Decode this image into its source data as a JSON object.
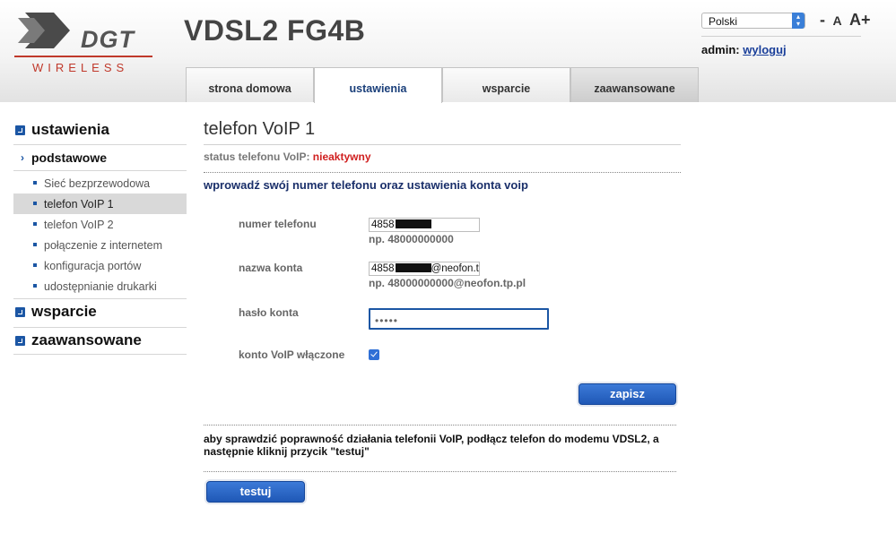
{
  "brand": {
    "logo_text": "DGT",
    "logo_subtext": "WIRELESS",
    "accent_color": "#c0392b"
  },
  "device_title": "VDSL2 FG4B",
  "header": {
    "language": "Polski",
    "font_size_controls": [
      "-",
      "A",
      "A+"
    ],
    "admin_label": "admin:",
    "logout_label": "wyloguj"
  },
  "tabs": [
    {
      "label": "strona domowa",
      "active": false
    },
    {
      "label": "ustawienia",
      "active": true
    },
    {
      "label": "wsparcie",
      "active": false
    },
    {
      "label": "zaawansowane",
      "active": false
    }
  ],
  "sidebar": {
    "section_settings": "ustawienia",
    "subsection": "podstawowe",
    "items": [
      {
        "label": "Sieć bezprzewodowa",
        "active": false
      },
      {
        "label": "telefon VoIP 1",
        "active": true
      },
      {
        "label": "telefon VoIP 2",
        "active": false
      },
      {
        "label": "połączenie z internetem",
        "active": false
      },
      {
        "label": "konfiguracja portów",
        "active": false
      },
      {
        "label": "udostępnianie drukarki",
        "active": false
      }
    ],
    "section_support": "wsparcie",
    "section_advanced": "zaawansowane"
  },
  "main": {
    "title": "telefon VoIP 1",
    "status_label": "status telefonu VoIP:",
    "status_value": "nieaktywny",
    "section_title": "wprowadź swój numer telefonu oraz ustawienia konta voip",
    "phone_label": "numer telefonu",
    "phone_value_prefix": "4858",
    "phone_hint": "np. 48000000000",
    "account_label": "nazwa konta",
    "account_value_prefix": "4858",
    "account_value_suffix": "@neofon.t",
    "account_hint": "np. 48000000000@neofon.tp.pl",
    "password_label": "hasło konta",
    "password_value": "•••••",
    "voip_enabled_label": "konto VoIP włączone",
    "voip_enabled": true,
    "save_label": "zapisz",
    "info_text": "aby sprawdzić poprawność działania telefonii VoIP, podłącz telefon do modemu VDSL2, a następnie kliknij przycik \"testuj\"",
    "test_label": "testuj"
  }
}
